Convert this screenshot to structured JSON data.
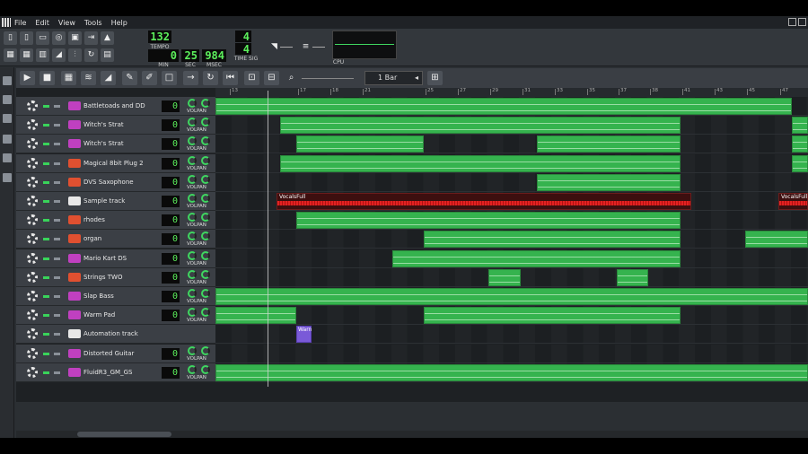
{
  "menu": {
    "items": [
      "File",
      "Edit",
      "View",
      "Tools",
      "Help"
    ]
  },
  "transport": {
    "tempo": "132",
    "tempo_label": "TEMPO",
    "min": "0",
    "sec": "25",
    "msec": "984",
    "min_label": "MIN",
    "sec_label": "SEC",
    "msec_label": "MSEC",
    "timesig_num": "4",
    "timesig_den": "4",
    "timesig_label": "TIME SIG",
    "cpu_label": "CPU"
  },
  "song_editor": {
    "zoom_value": "1 Bar",
    "timeline_ticks": [
      "13",
      "17",
      "18",
      "21",
      "25",
      "27",
      "29",
      "31",
      "33",
      "35",
      "37",
      "38",
      "41",
      "43",
      "45",
      "47"
    ]
  },
  "tracks": [
    {
      "name": "Battletoads and DD",
      "volume": "0",
      "icon": "sf2-icon"
    },
    {
      "name": "Witch's Strat",
      "volume": "0",
      "icon": "sf2-icon"
    },
    {
      "name": "Witch's Strat",
      "volume": "0",
      "icon": "sf2-icon"
    },
    {
      "name": "Magical 8bit Plug 2",
      "volume": "0",
      "icon": "vst-plug-icon"
    },
    {
      "name": "DVS Saxophone",
      "volume": "0",
      "icon": "vst-plug-icon"
    },
    {
      "name": "Sample track",
      "volume": "0",
      "icon": "waveform-icon"
    },
    {
      "name": "rhodes",
      "volume": "0",
      "icon": "vst-plug-icon"
    },
    {
      "name": "organ",
      "volume": "0",
      "icon": "vst-plug-icon"
    },
    {
      "name": "Mario Kart DS",
      "volume": "0",
      "icon": "sf2-icon"
    },
    {
      "name": "Strings TWO",
      "volume": "0",
      "icon": "vst-plug-icon"
    },
    {
      "name": "Slap Bass",
      "volume": "0",
      "icon": "sf2-icon"
    },
    {
      "name": "Warm Pad",
      "volume": "0",
      "icon": "sf2-icon"
    },
    {
      "name": "Automation track",
      "volume": "",
      "icon": "automation-icon"
    },
    {
      "name": "Distorted Guitar",
      "volume": "0",
      "icon": "sf2-icon"
    },
    {
      "name": "FluidR3_GM_GS",
      "volume": "0",
      "icon": "sf2-icon"
    }
  ],
  "knob_labels": {
    "vol": "VOL",
    "pan": "PAN"
  },
  "clips": {
    "sample_clip_label": "VocalsFull",
    "automation_clip_label": "Warn"
  },
  "colors": {
    "clip_green": "#35b34e",
    "sample_red": "#e32222",
    "automation_purple": "#7a5ad8",
    "lcd_green": "#5cf05c",
    "sf2_icon": "#c040c0",
    "vst_icon": "#e05030"
  }
}
